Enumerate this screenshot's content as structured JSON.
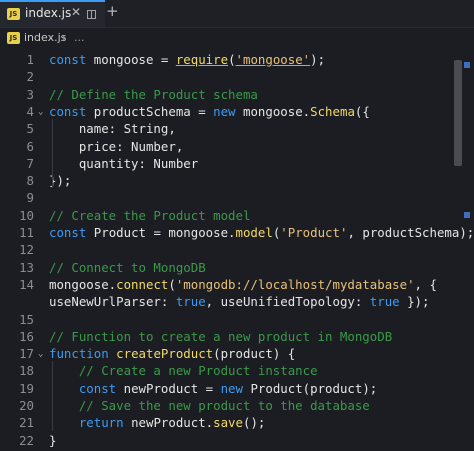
{
  "tab": {
    "label": "index.js",
    "icon": "javascript-file-icon",
    "close": "✕",
    "add": "+"
  },
  "breadcrumb": {
    "file": "index.js",
    "separator": "›",
    "more": "..."
  },
  "colors": {
    "keyword": "#3e9bf2",
    "comment": "#3a9a49",
    "string": "#e8c17a",
    "function": "#f2d96b",
    "plain": "#e5e5e5",
    "property": "#eaeaea"
  },
  "lines": [
    {
      "n": "1",
      "tokens": [
        [
          "keyword",
          "const"
        ],
        [
          "plain",
          " mongoose = "
        ],
        [
          "function",
          "require"
        ],
        [
          "plain",
          "("
        ],
        [
          "string",
          "'mongoose'"
        ],
        [
          "plain",
          ");"
        ]
      ]
    },
    {
      "n": "2",
      "tokens": []
    },
    {
      "n": "3",
      "tokens": [
        [
          "comment",
          "// Define the Product schema"
        ]
      ]
    },
    {
      "n": "4",
      "fold": true,
      "tokens": [
        [
          "keyword",
          "const"
        ],
        [
          "plain",
          " productSchema = "
        ],
        [
          "keyword",
          "new"
        ],
        [
          "plain",
          " mongoose."
        ],
        [
          "function",
          "Schema"
        ],
        [
          "plain",
          "({"
        ]
      ]
    },
    {
      "n": "5",
      "tokens": [
        [
          "plain",
          "    name: String,"
        ]
      ]
    },
    {
      "n": "6",
      "tokens": [
        [
          "plain",
          "    price: Number,"
        ]
      ]
    },
    {
      "n": "7",
      "tokens": [
        [
          "plain",
          "    quantity: Number"
        ]
      ]
    },
    {
      "n": "8",
      "tokens": [
        [
          "plain",
          "});"
        ]
      ]
    },
    {
      "n": "9",
      "tokens": []
    },
    {
      "n": "10",
      "tokens": [
        [
          "comment",
          "// Create the Product model"
        ]
      ]
    },
    {
      "n": "11",
      "tokens": [
        [
          "keyword",
          "const"
        ],
        [
          "plain",
          " Product = mongoose."
        ],
        [
          "function",
          "model"
        ],
        [
          "plain",
          "("
        ],
        [
          "string",
          "'Product'"
        ],
        [
          "plain",
          ", productSchema);"
        ]
      ]
    },
    {
      "n": "12",
      "tokens": []
    },
    {
      "n": "13",
      "tokens": [
        [
          "comment",
          "// Connect to MongoDB"
        ]
      ]
    },
    {
      "n": "14",
      "tokens": [
        [
          "plain",
          "mongoose."
        ],
        [
          "function",
          "connect"
        ],
        [
          "plain",
          "("
        ],
        [
          "string",
          "'mongodb://localhost/mydatabase'"
        ],
        [
          "plain",
          ", {"
        ]
      ]
    },
    {
      "n": "",
      "tokens": [
        [
          "plain",
          "useNewUrlParser: "
        ],
        [
          "keyword",
          "true"
        ],
        [
          "plain",
          ", useUnifiedTopology: "
        ],
        [
          "keyword",
          "true"
        ],
        [
          "plain",
          " });"
        ]
      ]
    },
    {
      "n": "15",
      "tokens": []
    },
    {
      "n": "16",
      "tokens": [
        [
          "comment",
          "// Function to create a new product in MongoDB"
        ]
      ]
    },
    {
      "n": "17",
      "fold": true,
      "tokens": [
        [
          "keyword",
          "function"
        ],
        [
          "plain",
          " "
        ],
        [
          "function",
          "createProduct"
        ],
        [
          "plain",
          "(product) {"
        ]
      ]
    },
    {
      "n": "18",
      "tokens": [
        [
          "comment",
          "    // Create a new Product instance"
        ]
      ]
    },
    {
      "n": "19",
      "tokens": [
        [
          "plain",
          "    "
        ],
        [
          "keyword",
          "const"
        ],
        [
          "plain",
          " newProduct = "
        ],
        [
          "keyword",
          "new"
        ],
        [
          "plain",
          " Product(product);"
        ]
      ]
    },
    {
      "n": "20",
      "tokens": [
        [
          "comment",
          "    // Save the new product to the database"
        ]
      ]
    },
    {
      "n": "21",
      "tokens": [
        [
          "plain",
          "    "
        ],
        [
          "keyword",
          "return"
        ],
        [
          "plain",
          " newProduct."
        ],
        [
          "function",
          "save"
        ],
        [
          "plain",
          "();"
        ]
      ]
    },
    {
      "n": "22",
      "tokens": [
        [
          "plain",
          "}"
        ]
      ]
    }
  ]
}
